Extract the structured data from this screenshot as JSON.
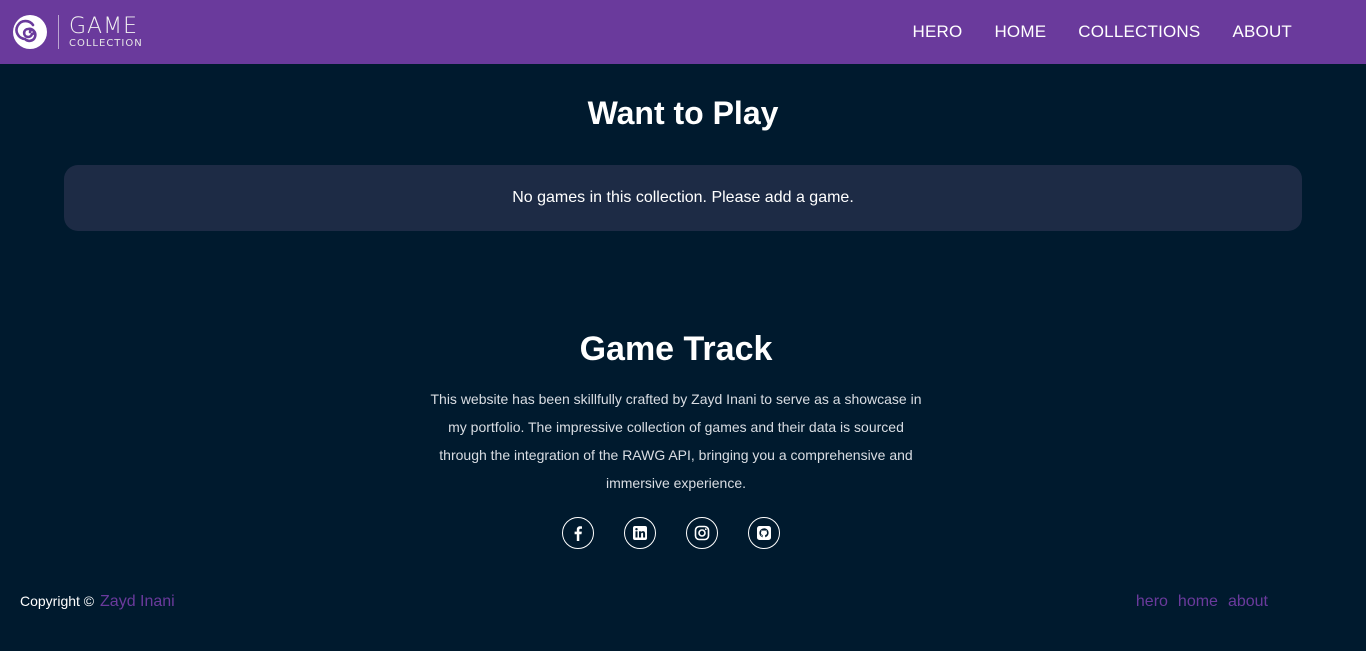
{
  "brand": {
    "name": "GAME",
    "subtitle": "COLLECTION",
    "logo_icon": "swirl-icon"
  },
  "nav": {
    "items": [
      {
        "label": "HERO"
      },
      {
        "label": "HOME"
      },
      {
        "label": "COLLECTIONS"
      },
      {
        "label": "ABOUT"
      }
    ]
  },
  "main": {
    "title": "Want to Play",
    "empty_message": "No games in this collection. Please add a game."
  },
  "footer": {
    "title": "Game Track",
    "description": "This website has been skillfully crafted by Zayd Inani to serve as a showcase in my portfolio. The impressive collection of games and their data is sourced through the integration of the RAWG API, bringing you a comprehensive and immersive experience.",
    "socials": [
      "facebook-icon",
      "linkedin-icon",
      "instagram-icon",
      "github-icon"
    ],
    "copyright_prefix": "Copyright ©",
    "copyright_name": "Zayd  Inani",
    "links": [
      {
        "label": "hero"
      },
      {
        "label": "home"
      },
      {
        "label": "about"
      }
    ]
  },
  "colors": {
    "navbar": "#6a3a9c",
    "background": "#001a2e",
    "card": "#1d2b45",
    "accent": "#6a3a9c"
  }
}
